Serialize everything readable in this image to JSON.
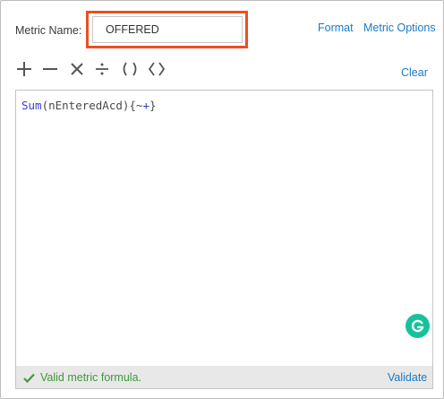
{
  "metric": {
    "name_label": "Metric Name:",
    "name_value": "OFFERED"
  },
  "header_links": {
    "format": "Format",
    "metric_options": "Metric Options"
  },
  "toolbar": {
    "operators": [
      "plus-icon",
      "minus-icon",
      "multiply-icon",
      "divide-icon",
      "parentheses-icon",
      "angle-brackets-icon"
    ],
    "clear": "Clear"
  },
  "editor": {
    "func": "Sum",
    "args": "(nEnteredAcd){~",
    "op": "+",
    "tail": "}"
  },
  "status": {
    "message": "Valid metric formula.",
    "validate": "Validate"
  },
  "colors": {
    "highlight": "#f04e23",
    "link": "#1b7ac6",
    "valid": "#3e9a3a",
    "grammarly": "#15c39a"
  }
}
